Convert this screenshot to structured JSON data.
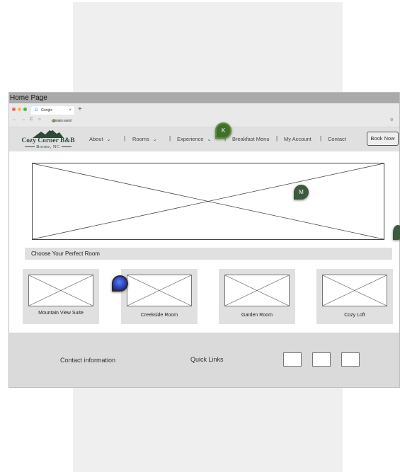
{
  "frame": {
    "title": "Home Page"
  },
  "browser": {
    "tab_label": "Google",
    "tab_icon": "G",
    "tab_close": "×",
    "new_tab": "+",
    "nav_back": "←",
    "nav_forward": "→",
    "nav_reload": "C",
    "nav_home": "⌂",
    "url_host": "domain.com/",
    "url_path": "subdomain/"
  },
  "site": {
    "logo": {
      "title": "Cozy Corner B&B",
      "subtitle": "Boone, NC"
    },
    "menu": [
      {
        "label": "About",
        "chevron": "⌄"
      },
      {
        "label": "Rooms",
        "chevron": "⌄"
      },
      {
        "label": "Experience",
        "chevron": "⌄"
      },
      {
        "label": "Breakfast Menu"
      },
      {
        "label": "My Account"
      },
      {
        "label": "Contact"
      }
    ],
    "separator": "|",
    "book_button": "Book Now"
  },
  "section": {
    "title": "Choose Your Perfect Room"
  },
  "rooms": [
    {
      "name": "Mountain View Suite"
    },
    {
      "name": "Creekside Room"
    },
    {
      "name": "Garden Room"
    },
    {
      "name": "Cozy Loft"
    }
  ],
  "footer": {
    "contact": "Contact information",
    "quick_links": "Quick Links"
  },
  "comments": [
    {
      "initial": "K"
    },
    {
      "initial": "M"
    }
  ],
  "colors": {
    "brand_green": "#2f4a3a",
    "comment_green": "#3f6f2a",
    "nav_bg": "#e0e0e0"
  }
}
